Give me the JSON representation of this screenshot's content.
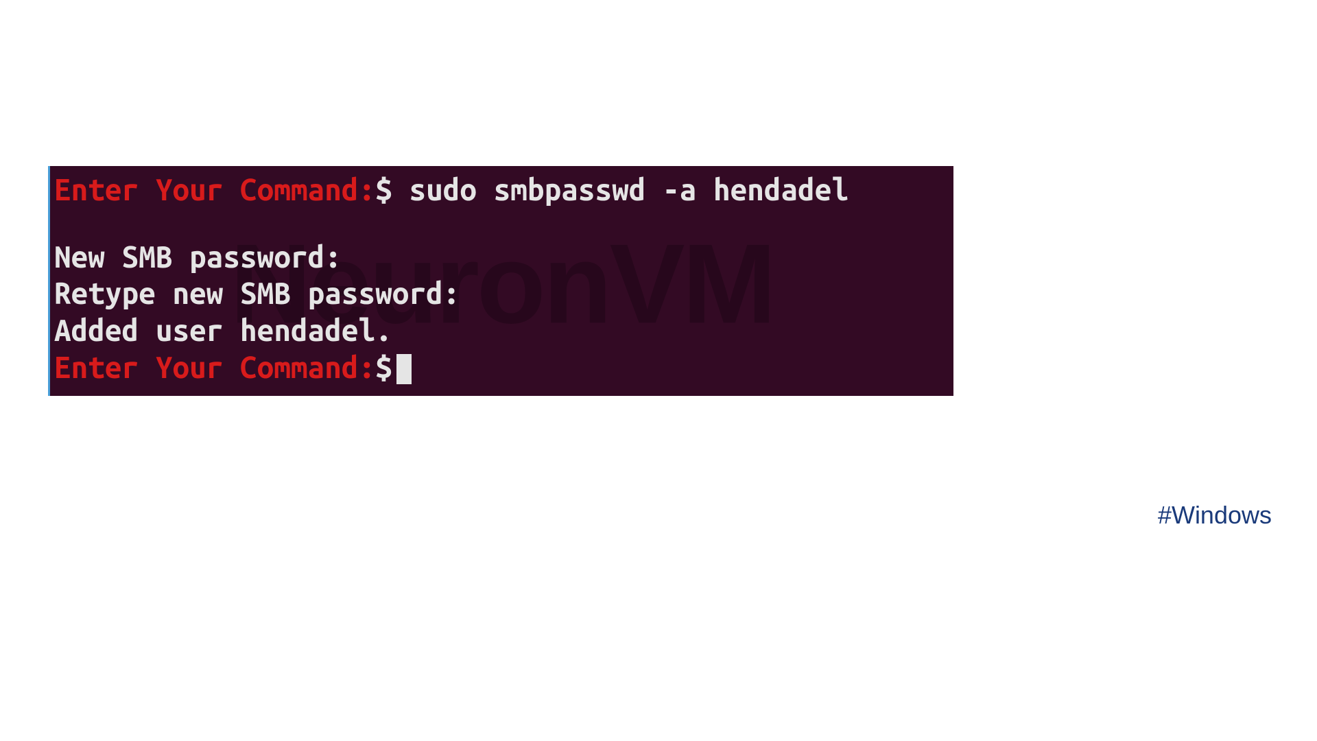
{
  "terminal": {
    "prompt_label": "Enter Your Command:",
    "prompt_symbol": "$",
    "command_1": "sudo smbpasswd -a hendadel",
    "output_line_1": "New SMB password:",
    "output_line_2": "Retype new SMB password:",
    "output_line_3": "Added user hendadel.",
    "watermark": "NeuronVM"
  },
  "footer": {
    "hashtag": "#Windows"
  }
}
